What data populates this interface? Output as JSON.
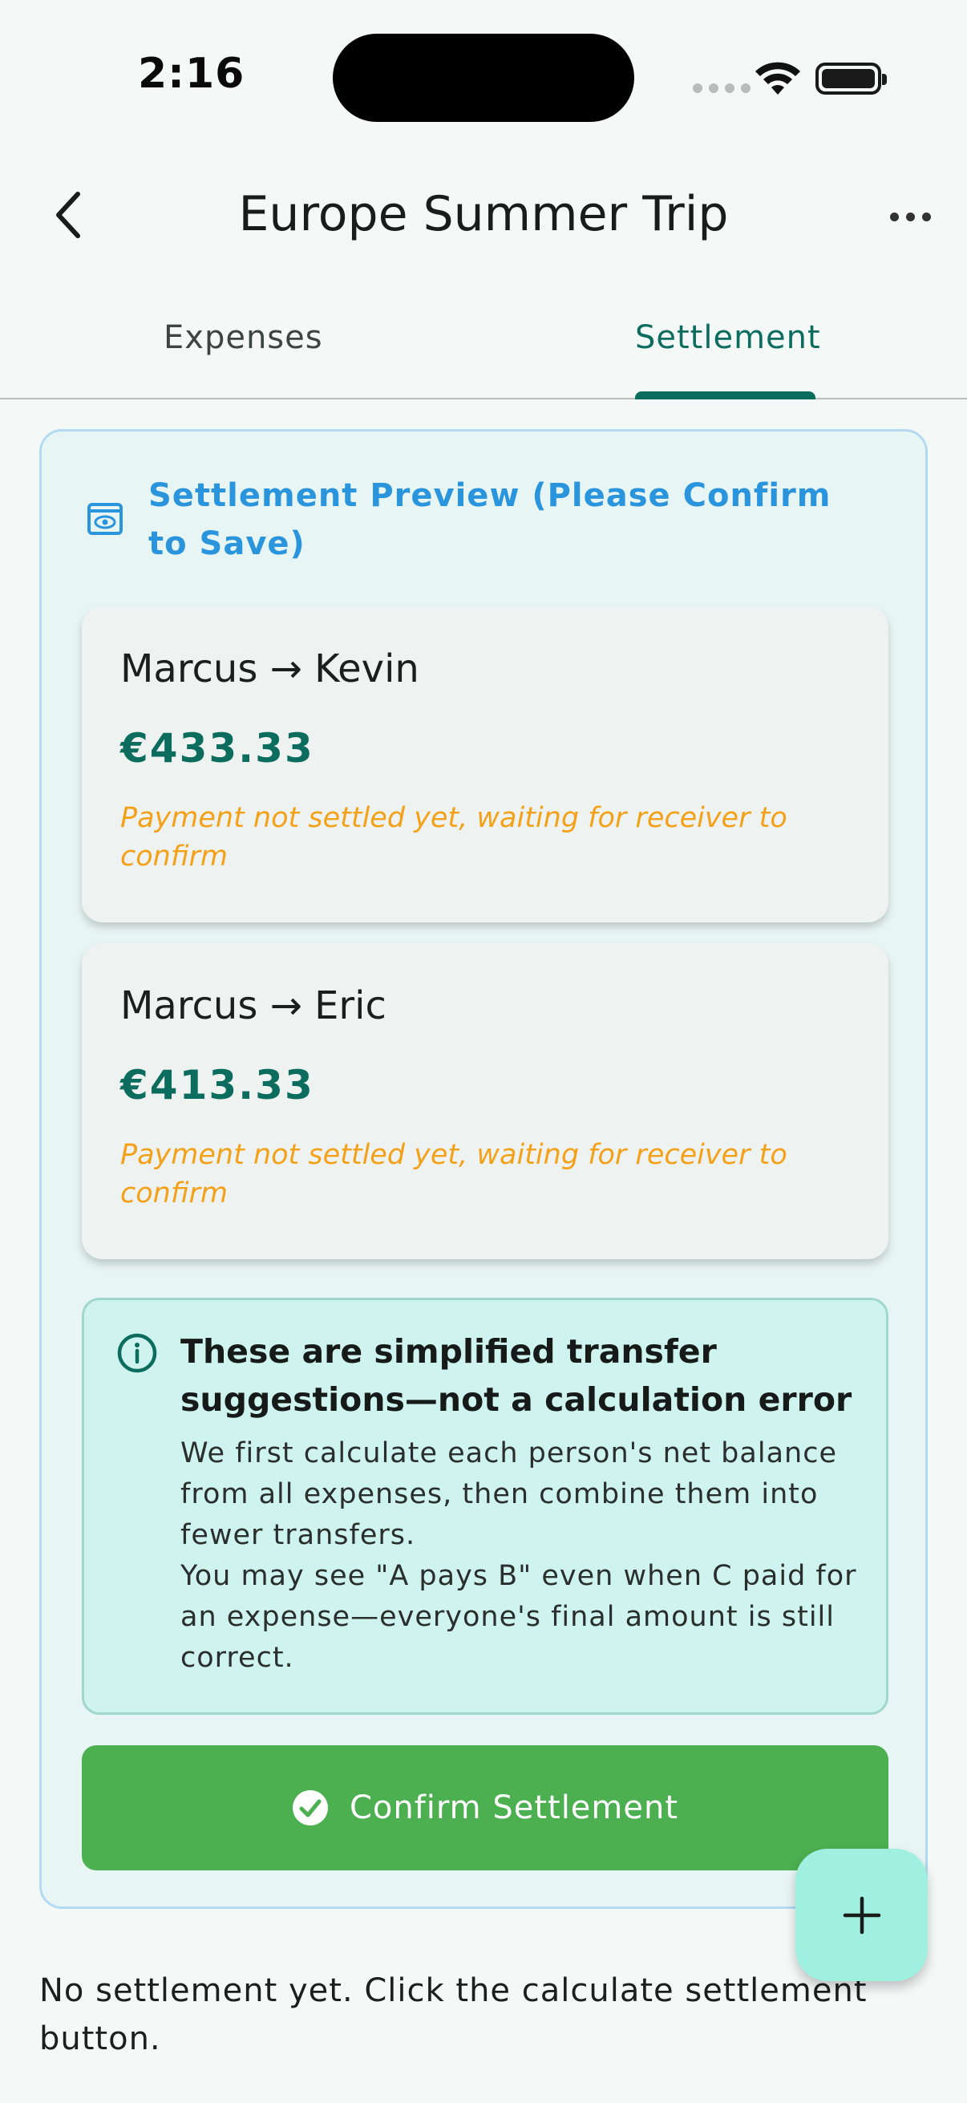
{
  "status_bar": {
    "time": "2:16"
  },
  "header": {
    "title": "Europe Summer Trip"
  },
  "tabs": [
    {
      "label": "Expenses",
      "selected": false
    },
    {
      "label": "Settlement",
      "selected": true
    }
  ],
  "preview": {
    "title": "Settlement Preview (Please Confirm to Save)",
    "transfers": [
      {
        "names": "Marcus → Kevin",
        "amount": "€433.33",
        "status": "Payment not settled yet, waiting for receiver to confirm"
      },
      {
        "names": "Marcus → Eric",
        "amount": "€413.33",
        "status": "Payment not settled yet, waiting for receiver to confirm"
      }
    ],
    "info": {
      "title": "These are simplified transfer suggestions—not a calculation error",
      "line1": "We first calculate each person's net balance from all expenses, then combine them into fewer transfers.",
      "line2": "You may see \"A pays B\" even when C paid for an expense—everyone's final amount is still correct."
    },
    "confirm_label": "Confirm Settlement"
  },
  "empty_note": "No settlement yet. Click the calculate settlement button.",
  "colors": {
    "accent": "#0c6d5f",
    "preview_title": "#2a95dc",
    "pending_status": "#f4a11a",
    "confirm_button": "#4caf50",
    "fab": "#9ff0e0"
  },
  "icons": [
    "back-icon",
    "more-icon",
    "eye-icon",
    "info-icon",
    "check-circle-icon",
    "plus-icon"
  ]
}
